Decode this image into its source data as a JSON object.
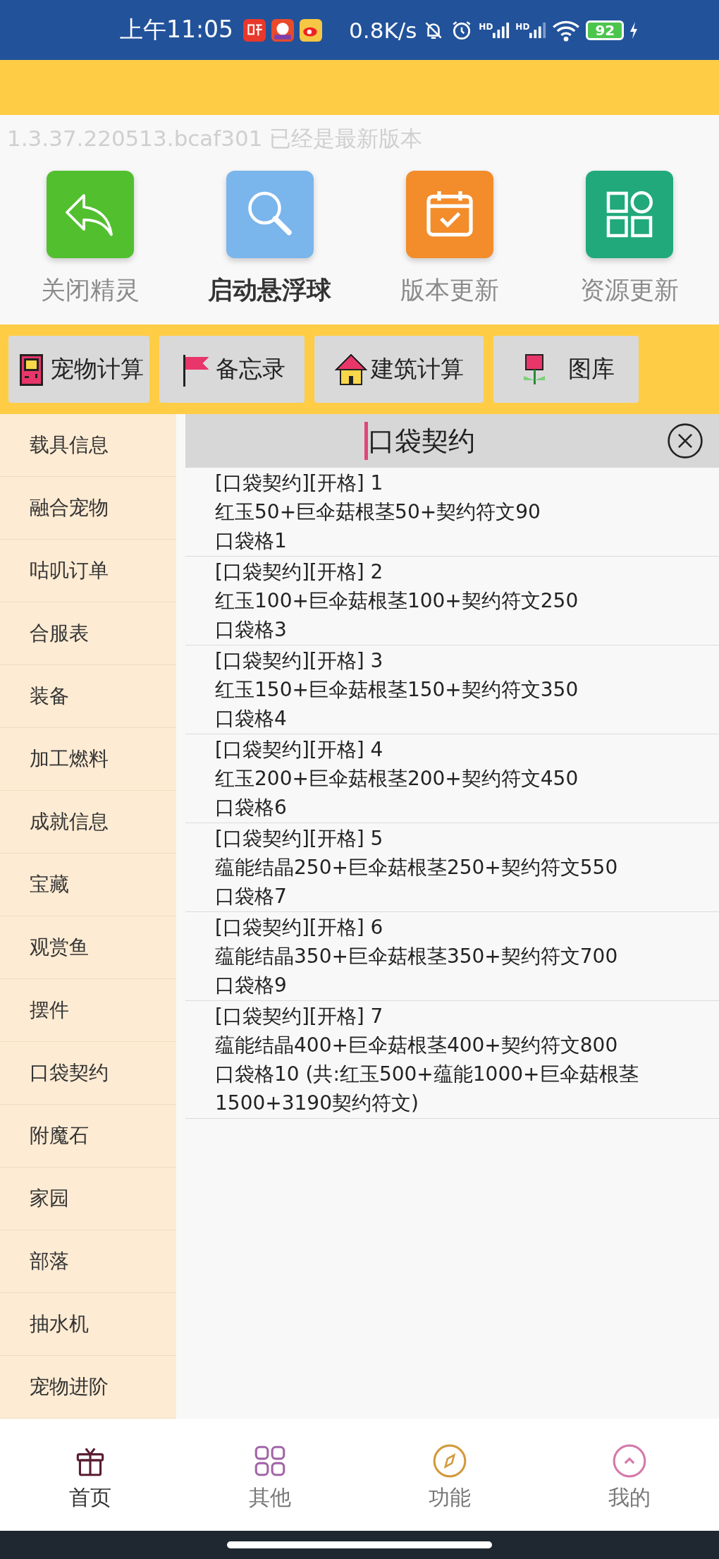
{
  "status_bar": {
    "time": "上午11:05",
    "network_speed": "0.8K/s",
    "signal_labels": [
      "HD",
      "HD"
    ],
    "battery": "92"
  },
  "version_notice": "1.3.37.220513.bcaf301 已经是最新版本",
  "shortcuts": [
    {
      "kind": "close",
      "label": "关闭精灵",
      "active": false
    },
    {
      "kind": "search",
      "label": "启动悬浮球",
      "active": true
    },
    {
      "kind": "calendar",
      "label": "版本更新",
      "active": false
    },
    {
      "kind": "grid",
      "label": "资源更新",
      "active": false
    }
  ],
  "tools": [
    {
      "kind": "game",
      "label": "宠物计算"
    },
    {
      "kind": "flag",
      "label": "备忘录"
    },
    {
      "kind": "house",
      "label": "建筑计算"
    },
    {
      "kind": "flower",
      "label": "图库"
    }
  ],
  "sidebar": {
    "items": [
      "载具信息",
      "融合宠物",
      "咕叽订单",
      "合服表",
      "装备",
      "加工燃料",
      "成就信息",
      "宝藏",
      "观赏鱼",
      "摆件",
      "口袋契约",
      "附魔石",
      "家园",
      "部落",
      "抽水机",
      "宠物进阶"
    ]
  },
  "search": {
    "value": "口袋契约"
  },
  "results": [
    {
      "lines": [
        "[口袋契约][开格] 1",
        "红玉50+巨伞菇根茎50+契约符文90",
        "口袋格1"
      ]
    },
    {
      "lines": [
        "[口袋契约][开格] 2",
        "红玉100+巨伞菇根茎100+契约符文250",
        "口袋格3"
      ]
    },
    {
      "lines": [
        "[口袋契约][开格] 3",
        "红玉150+巨伞菇根茎150+契约符文350",
        "口袋格4"
      ]
    },
    {
      "lines": [
        "[口袋契约][开格] 4",
        "红玉200+巨伞菇根茎200+契约符文450",
        "口袋格6"
      ]
    },
    {
      "lines": [
        "[口袋契约][开格] 5",
        "蕴能结晶250+巨伞菇根茎250+契约符文550",
        "口袋格7"
      ]
    },
    {
      "lines": [
        "[口袋契约][开格] 6",
        "蕴能结晶350+巨伞菇根茎350+契约符文700",
        "口袋格9"
      ]
    },
    {
      "lines": [
        "[口袋契约][开格] 7",
        "蕴能结晶400+巨伞菇根茎400+契约符文800",
        "口袋格10 (共:红玉500+蕴能1000+巨伞菇根茎1500+3190契约符文)"
      ]
    }
  ],
  "bottom_nav": [
    {
      "kind": "gift",
      "label": "首页",
      "selected": true
    },
    {
      "kind": "grid",
      "label": "其他",
      "selected": false
    },
    {
      "kind": "compass",
      "label": "功能",
      "selected": false
    },
    {
      "kind": "up",
      "label": "我的",
      "selected": false
    }
  ]
}
